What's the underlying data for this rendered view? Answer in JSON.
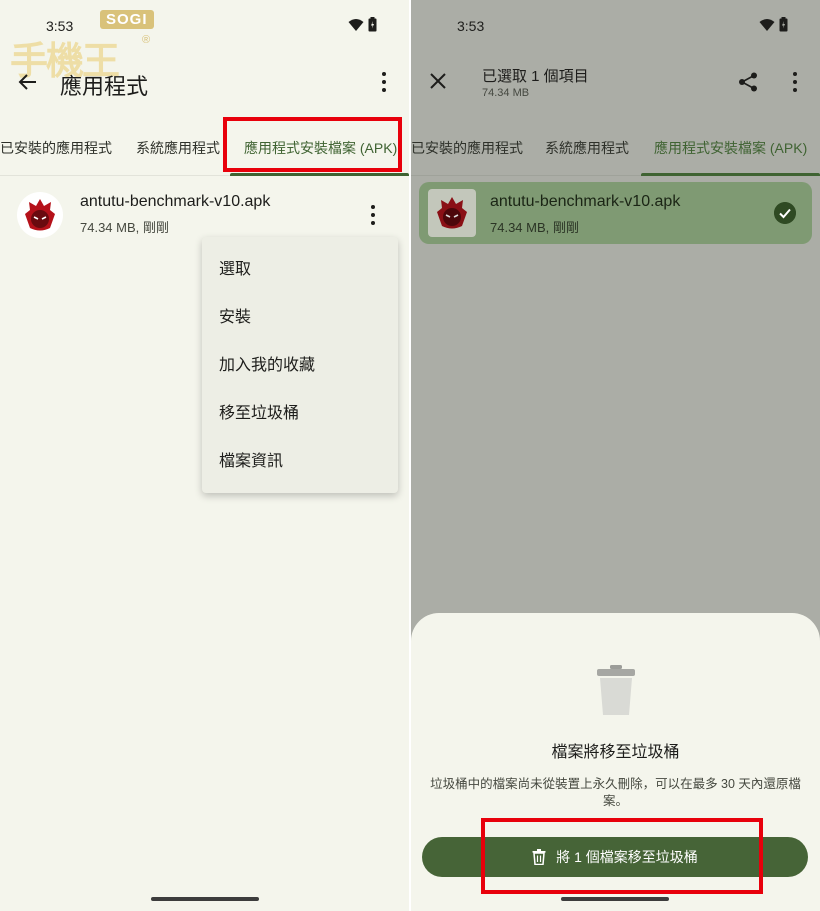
{
  "left": {
    "status": {
      "time": "3:53"
    },
    "watermark": {
      "brand": "SOGI",
      "chinese": "手機王",
      "reg": "®"
    },
    "appbar": {
      "title": "應用程式"
    },
    "tabs": [
      {
        "label": "已安裝的應用程式"
      },
      {
        "label": "系統應用程式"
      },
      {
        "label": "應用程式安裝檔案 (APK)"
      }
    ],
    "file": {
      "name": "antutu-benchmark-v10.apk",
      "meta": "74.34 MB, 剛剛"
    },
    "menu": [
      {
        "label": "選取"
      },
      {
        "label": "安裝"
      },
      {
        "label": "加入我的收藏"
      },
      {
        "label": "移至垃圾桶"
      },
      {
        "label": "檔案資訊"
      }
    ]
  },
  "right": {
    "status": {
      "time": "3:53"
    },
    "appbar": {
      "title": "已選取 1 個項目",
      "subtitle": "74.34 MB"
    },
    "tabs": [
      {
        "label": "已安裝的應用程式"
      },
      {
        "label": "系統應用程式"
      },
      {
        "label": "應用程式安裝檔案 (APK)"
      }
    ],
    "file": {
      "name": "antutu-benchmark-v10.apk",
      "meta": "74.34 MB, 剛剛"
    },
    "sheet": {
      "title": "檔案將移至垃圾桶",
      "body": "垃圾桶中的檔案尚未從裝置上永久刪除，可以在最多 30 天內還原檔案。",
      "button": "將 1 個檔案移至垃圾桶"
    }
  },
  "colors": {
    "accent": "#3f6332",
    "highlight": "#e8000b",
    "button": "#466437",
    "selected": "#7f9a73"
  }
}
